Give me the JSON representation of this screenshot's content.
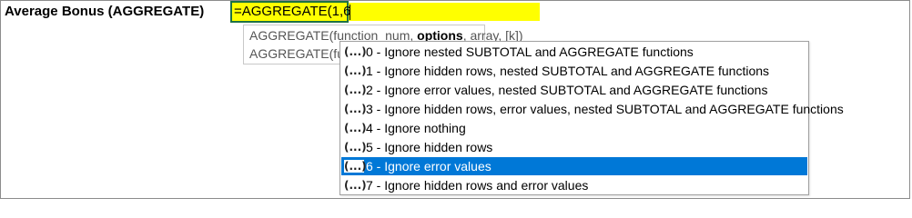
{
  "cell": {
    "row_label": "Average Bonus (AGGREGATE)"
  },
  "formula_bar": {
    "text": "=AGGREGATE(1,6"
  },
  "tooltip": {
    "line1": {
      "pre": "AGGREGATE(function_num, ",
      "bold": "options",
      "post": ", array, [k])"
    },
    "line2": "AGGREGATE(fu"
  },
  "dropdown": {
    "icon_glyph": "(...)",
    "selected_index": 6,
    "options": [
      "0 - Ignore nested SUBTOTAL and AGGREGATE functions",
      "1 - Ignore hidden rows, nested SUBTOTAL and AGGREGATE functions",
      "2 - Ignore error values, nested SUBTOTAL and AGGREGATE functions",
      "3 - Ignore hidden rows, error values, nested SUBTOTAL and AGGREGATE functions",
      "4 - Ignore nothing",
      "5 - Ignore hidden rows",
      "6 - Ignore error values",
      "7 - Ignore hidden rows and error values"
    ]
  },
  "colors": {
    "highlight": "#ffff00",
    "selection": "#0078d7",
    "active_border": "#1e7145"
  }
}
